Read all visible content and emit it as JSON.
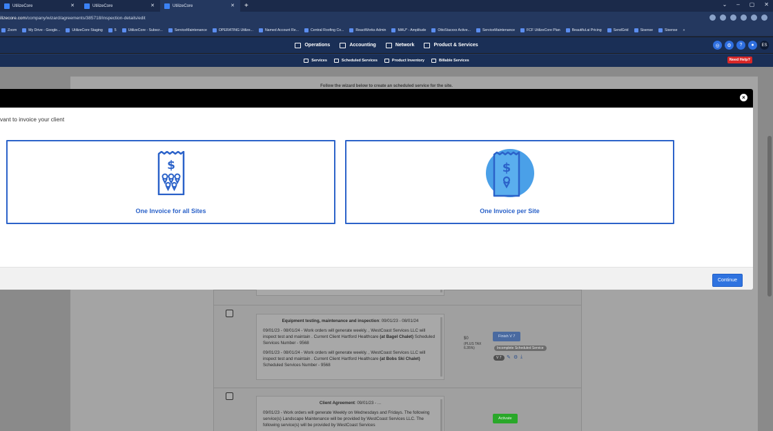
{
  "browser": {
    "tabs": [
      {
        "label": "UtilizeCore"
      },
      {
        "label": "UtilizeCore"
      },
      {
        "label": "UtilizeCore"
      }
    ],
    "new_tab": "+",
    "window_controls": [
      "⌄",
      "–",
      "▢",
      "✕"
    ],
    "url_host": "ilizecore.com",
    "url_path": "/company/wizard/agreements/385718/inspection-details/edit",
    "bookmarks": [
      "Zoom",
      "My Drive - Google...",
      "UtilizeCore Staging",
      "5",
      "UtilizeCore - Subscr...",
      "ServiceMaintenance",
      "OPERATING Utilize...",
      "Named Account Re...",
      "Central Roofing Co...",
      "ReactWorks Admin",
      "MAU* - Amplitude",
      "OttoStacxxx Active...",
      "ServiceMaintenance",
      "FCF UtilizeCore Plan",
      "Beautiful.ai Pricing",
      "SendGrid",
      "Sisense",
      "Sisense",
      "»"
    ]
  },
  "app_nav": {
    "primary": [
      {
        "label": "Operations"
      },
      {
        "label": "Accounting"
      },
      {
        "label": "Network"
      },
      {
        "label": "Product & Services"
      }
    ],
    "secondary": [
      {
        "label": "Services"
      },
      {
        "label": "Scheduled Services"
      },
      {
        "label": "Product Inventory"
      },
      {
        "label": "Billable Services"
      }
    ],
    "user_initials": "ES",
    "help_label": "Need Help?"
  },
  "page": {
    "wizard_message": "Follow the wizard below to create an scheduled service for the site.",
    "rows": [
      {
        "title": "Equipment testing, maintenance and inspection",
        "dates": ": 09/01/23 - 08/01/24",
        "p1a": "09/01/23 - 08/01/24 - Work orders will generate weekly. , WestCoast Services LLC will inspect test and maintain . Current Client Hartford Healthcare ",
        "p1b": "(at Bagel Chalet)",
        "p1c": " Scheduled Services Number - 9568",
        "p2a": "09/01/23 - 08/01/24 - Work orders will generate weekly. , WestCoast Services LLC will inspect test and maintain . Current Client Hartford Healthcare ",
        "p2b": "(at Bobs Ski Chalet)",
        "p2c": " Scheduled Services Number - 9568",
        "price": "$0",
        "tax": "(PLUS TAX",
        "tax2": "6.35%)",
        "action": "Finish V 7",
        "status": "Incomplete Scheduled Service",
        "version": "V 7"
      },
      {
        "title": "Client Agreement",
        "dates": ": 09/01/23 - ...",
        "p1a": "09/01/23 - Work orders will generate Weekly on Wednesdays and Fridays. The following service(s) Landscape Maintenance will be provided by WestCoast Services LLC. The following service(s) will be provided by WestCoast Services",
        "action": "Activate"
      }
    ]
  },
  "modal": {
    "question": "vant to invoice your client",
    "options": [
      {
        "label": "One Invoice for all Sites",
        "icon": "receipt-multi-pin-icon"
      },
      {
        "label": "One Invoice per Site",
        "icon": "receipt-single-pin-icon"
      }
    ],
    "close": "×",
    "continue_label": "Continue"
  },
  "colors": {
    "accent": "#2b62c9",
    "nav_bg": "#1a2f56",
    "help": "#d92727",
    "activate": "#2aa82a"
  }
}
